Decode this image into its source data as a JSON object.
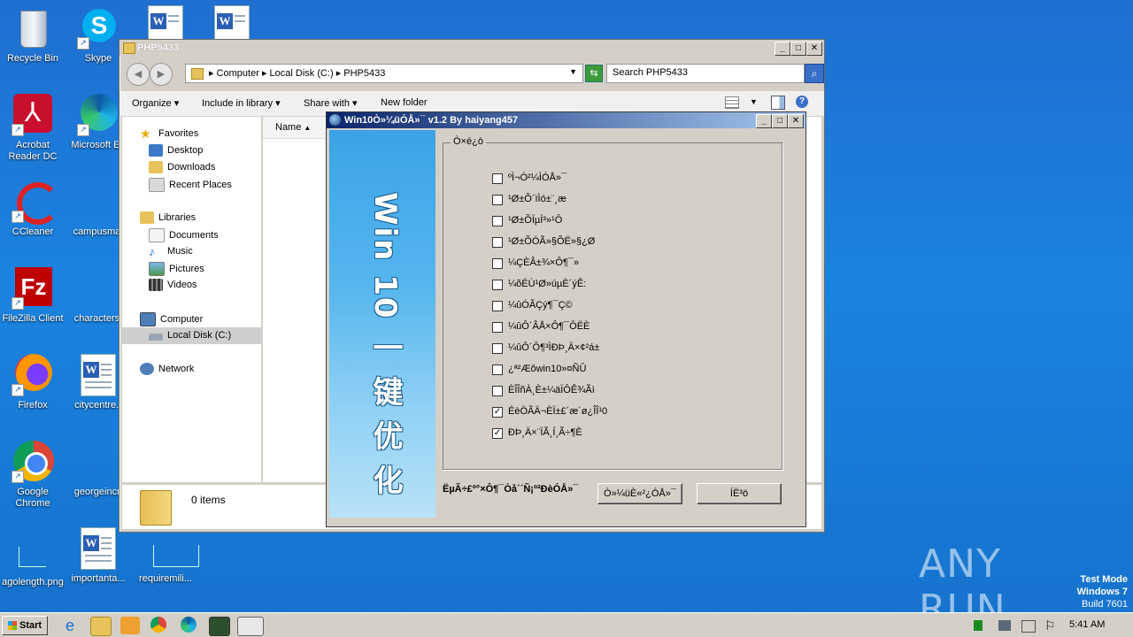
{
  "desktop": {
    "icons": [
      {
        "label": "Recycle Bin"
      },
      {
        "label": "Skype"
      },
      {
        "label": "Acrobat Reader DC"
      },
      {
        "label": "Microsoft Ed"
      },
      {
        "label": "CCleaner"
      },
      {
        "label": "campusmat"
      },
      {
        "label": "FileZilla Client"
      },
      {
        "label": "characterst"
      },
      {
        "label": "Firefox"
      },
      {
        "label": "citycentre.r"
      },
      {
        "label": "Google Chrome"
      },
      {
        "label": "georgeincr."
      },
      {
        "label": "agolength.png"
      },
      {
        "label": "importanta..."
      },
      {
        "label": "requiremili..."
      }
    ],
    "watermark": {
      "brand": "ANY RUN",
      "line1": "Test Mode",
      "line2": "Windows 7",
      "line3": "Build 7601"
    }
  },
  "explorer": {
    "title": "PHP5433",
    "address": [
      "Computer",
      "Local Disk (C:)",
      "PHP5433"
    ],
    "search_placeholder": "Search PHP5433",
    "toolbar": {
      "organize": "Organize",
      "include": "Include in library",
      "share": "Share with",
      "newfolder": "New folder"
    },
    "column_name": "Name",
    "nav": {
      "favorites": "Favorites",
      "desktop": "Desktop",
      "downloads": "Downloads",
      "recent": "Recent Places",
      "libraries": "Libraries",
      "documents": "Documents",
      "music": "Music",
      "pictures": "Pictures",
      "videos": "Videos",
      "computer": "Computer",
      "localdisk": "Local Disk (C:)",
      "network": "Network"
    },
    "status": "0 items"
  },
  "dialog": {
    "title": "Win10Ò»¼üÓÅ»¯ v1.2  By haiyang457",
    "banner_text": "Win 10 一 键 优 化",
    "group_label": "Ò×é¿ò",
    "options": [
      {
        "label": "ºÌ¬Ó²¼ÌÓÅ»¯",
        "checked": false
      },
      {
        "label": "¹Ø±Õ´ïÌó±¨¸æ",
        "checked": false
      },
      {
        "label": "¹Ø±ÕÏµÍ³»¹Ô­",
        "checked": false
      },
      {
        "label": "¹Ø±ÕÓÃ»§ÕË»§¿Ø",
        "checked": false
      },
      {
        "label": "¼ÇÈÂ±¾×Ô¶¯»",
        "checked": false
      },
      {
        "label": "¼õÉÙ¹Ø»úµÈ´ýÊ:",
        "checked": false
      },
      {
        "label": "¼ûÓÃÇý¶¯Ç©",
        "checked": false
      },
      {
        "label": "¼ûÔ´ÂÅ×Ô¶¯ÔËÈ",
        "checked": false
      },
      {
        "label": "¼ûÔ´Ô¶³ÌÐÞ¸Ä×¢²á±",
        "checked": false
      },
      {
        "label": "¿ª²Æôwin10»¤ÑÛ",
        "checked": false
      },
      {
        "label": "ÈÎÎñÀ¸È±¼äÏÔÊ¾Ãì",
        "checked": false
      },
      {
        "label": "ÉèÖÃÄ¬ÈÏ±£´æ´ø¿ÎÎ¹0",
        "checked": true
      },
      {
        "label": "ÐÞ¸Ä×¨ÏÃ¸Í¸Ã÷¶È",
        "checked": true
      }
    ],
    "footer_text": "ËµÃ÷£º°×Ô¶¯Òå´´Ñ¡º²ÐèÓÅ»¯",
    "btn_optimize": "Ò»¼üÈ«²¿ÓÅ»¯",
    "btn_exit": "ÍË³ö"
  },
  "taskbar": {
    "start": "Start",
    "time": "5:41 AM"
  }
}
